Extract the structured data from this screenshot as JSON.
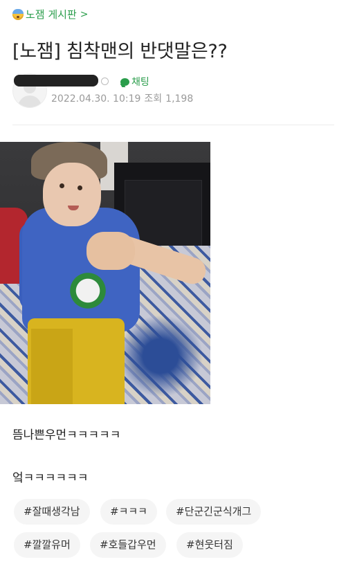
{
  "board": {
    "label": "노잼 게시판",
    "chevron": ">"
  },
  "post": {
    "title": "[노잼] 침착맨의 반댓말은??",
    "author": {
      "chat_label": "채팅",
      "date": "2022.04.30. 10:19",
      "views_label": "조회",
      "views": "1,198"
    },
    "body_lines": [
      "뜸나쁜우먼ㅋㅋㅋㅋㅋ",
      "엌ㅋㅋㅋㅋㅋㅋ"
    ],
    "tags": [
      "#잘때생각남",
      "#ㅋㅋㅋ",
      "#단군긴군식개그",
      "#깔깔유머",
      "#호들갑우먼",
      "#현웃터짐"
    ]
  },
  "colors": {
    "accent": "#2a9d4b",
    "meta": "#9a9a9a",
    "tag_bg": "#f5f5f5"
  }
}
